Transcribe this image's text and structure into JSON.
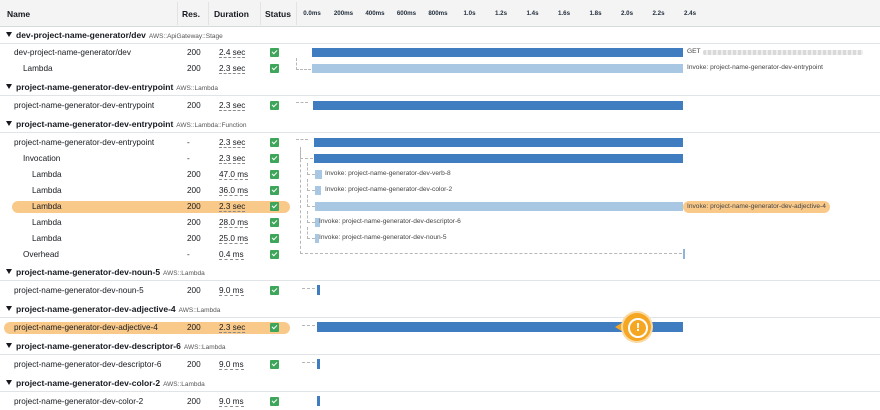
{
  "header": {
    "name": "Name",
    "res": "Res.",
    "duration": "Duration",
    "status": "Status",
    "ticks": [
      "0.0ms",
      "200ms",
      "400ms",
      "600ms",
      "800ms",
      "1.0s",
      "1.2s",
      "1.4s",
      "1.6s",
      "1.8s",
      "2.0s",
      "2.2s",
      "2.4s"
    ]
  },
  "groups": {
    "g1": {
      "name": "dev-project-name-generator/dev",
      "type": "AWS::ApiGateway::Stage"
    },
    "g2": {
      "name": "project-name-generator-dev-entrypoint",
      "type": "AWS::Lambda"
    },
    "g3": {
      "name": "project-name-generator-dev-entrypoint",
      "type": "AWS::Lambda::Function"
    },
    "g4": {
      "name": "project-name-generator-dev-noun-5",
      "type": "AWS::Lambda"
    },
    "g5": {
      "name": "project-name-generator-dev-adjective-4",
      "type": "AWS::Lambda"
    },
    "g6": {
      "name": "project-name-generator-dev-descriptor-6",
      "type": "AWS::Lambda"
    },
    "g7": {
      "name": "project-name-generator-dev-color-2",
      "type": "AWS::Lambda"
    }
  },
  "rows": {
    "r1": {
      "name": "dev-project-name-generator/dev",
      "res": "200",
      "dur": "2.4 sec",
      "label": "GET"
    },
    "r2": {
      "name": "Lambda",
      "res": "200",
      "dur": "2.3 sec",
      "label": "Invoke: project-name-generator-dev-entrypoint"
    },
    "r3": {
      "name": "project-name-generator-dev-entrypoint",
      "res": "200",
      "dur": "2.3 sec"
    },
    "r4": {
      "name": "project-name-generator-dev-entrypoint",
      "res": "-",
      "dur": "2.3 sec"
    },
    "r5": {
      "name": "Invocation",
      "res": "-",
      "dur": "2.3 sec"
    },
    "r6": {
      "name": "Lambda",
      "res": "200",
      "dur": "47.0 ms",
      "label": "Invoke: project-name-generator-dev-verb-8"
    },
    "r7": {
      "name": "Lambda",
      "res": "200",
      "dur": "36.0 ms",
      "label": "Invoke: project-name-generator-dev-color-2"
    },
    "r8": {
      "name": "Lambda",
      "res": "200",
      "dur": "2.3 sec",
      "label": "Invoke: project-name-generator-dev-adjective-4"
    },
    "r9": {
      "name": "Lambda",
      "res": "200",
      "dur": "28.0 ms",
      "label": "Invoke: project-name-generator-dev-descriptor-6"
    },
    "r10": {
      "name": "Lambda",
      "res": "200",
      "dur": "25.0 ms",
      "label": "Invoke: project-name-generator-dev-noun-5"
    },
    "r11": {
      "name": "Overhead",
      "res": "-",
      "dur": "0.4 ms"
    },
    "r12": {
      "name": "project-name-generator-dev-noun-5",
      "res": "200",
      "dur": "9.0 ms"
    },
    "r13": {
      "name": "project-name-generator-dev-adjective-4",
      "res": "200",
      "dur": "2.3 sec"
    },
    "r14": {
      "name": "project-name-generator-dev-descriptor-6",
      "res": "200",
      "dur": "9.0 ms"
    },
    "r15": {
      "name": "project-name-generator-dev-color-2",
      "res": "200",
      "dur": "9.0 ms"
    }
  },
  "alert": {
    "icon": "!"
  },
  "colors": {
    "bar_primary": "#3f7cc0",
    "bar_secondary": "#a8c7e3",
    "highlight": "#f9c989",
    "status_ok": "#3ea65a",
    "alert": "#f5a623"
  }
}
